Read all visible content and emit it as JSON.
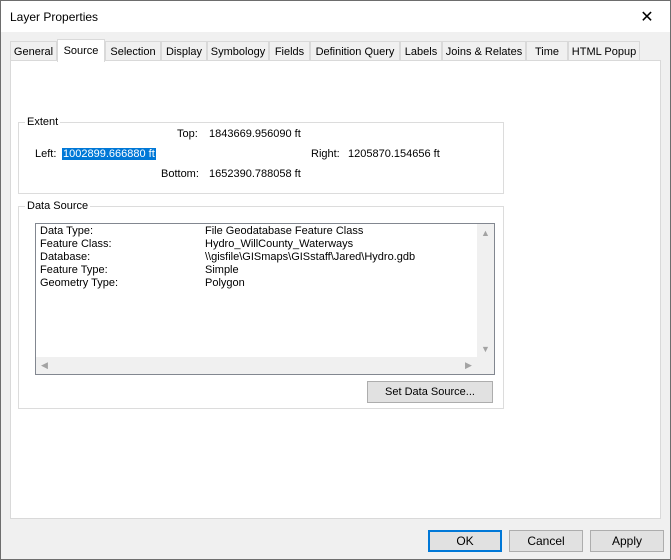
{
  "window": {
    "title": "Layer Properties",
    "close_glyph": "✕"
  },
  "tabs": [
    {
      "label": "General",
      "active": false
    },
    {
      "label": "Source",
      "active": true
    },
    {
      "label": "Selection",
      "active": false
    },
    {
      "label": "Display",
      "active": false
    },
    {
      "label": "Symbology",
      "active": false
    },
    {
      "label": "Fields",
      "active": false
    },
    {
      "label": "Definition Query",
      "active": false
    },
    {
      "label": "Labels",
      "active": false
    },
    {
      "label": "Joins & Relates",
      "active": false
    },
    {
      "label": "Time",
      "active": false
    },
    {
      "label": "HTML Popup",
      "active": false
    }
  ],
  "extent": {
    "legend": "Extent",
    "top_label": "Top:",
    "top_value": "1843669.956090 ft",
    "left_label": "Left:",
    "left_value": "1002899.666880 ft",
    "right_label": "Right:",
    "right_value": "1205870.154656 ft",
    "bottom_label": "Bottom:",
    "bottom_value": "1652390.788058 ft"
  },
  "data_source": {
    "legend": "Data Source",
    "rows": [
      {
        "key": "Data Type:",
        "value": "File Geodatabase Feature Class"
      },
      {
        "key": "Feature Class:",
        "value": "Hydro_WillCounty_Waterways"
      },
      {
        "key": "Database:",
        "value": "\\\\gisfile\\GISmaps\\GISstaff\\Jared\\Hydro.gdb"
      },
      {
        "key": "Feature Type:",
        "value": "Simple"
      },
      {
        "key": "Geometry Type:",
        "value": "Polygon"
      }
    ],
    "set_button": "Set Data Source...",
    "scroll_up": "▲",
    "scroll_down": "▼",
    "scroll_left": "◀",
    "scroll_right": "▶"
  },
  "footer": {
    "ok": "OK",
    "cancel": "Cancel",
    "apply": "Apply"
  },
  "colors": {
    "selection": "#0078d7",
    "default_button_border": "#0078d7"
  }
}
